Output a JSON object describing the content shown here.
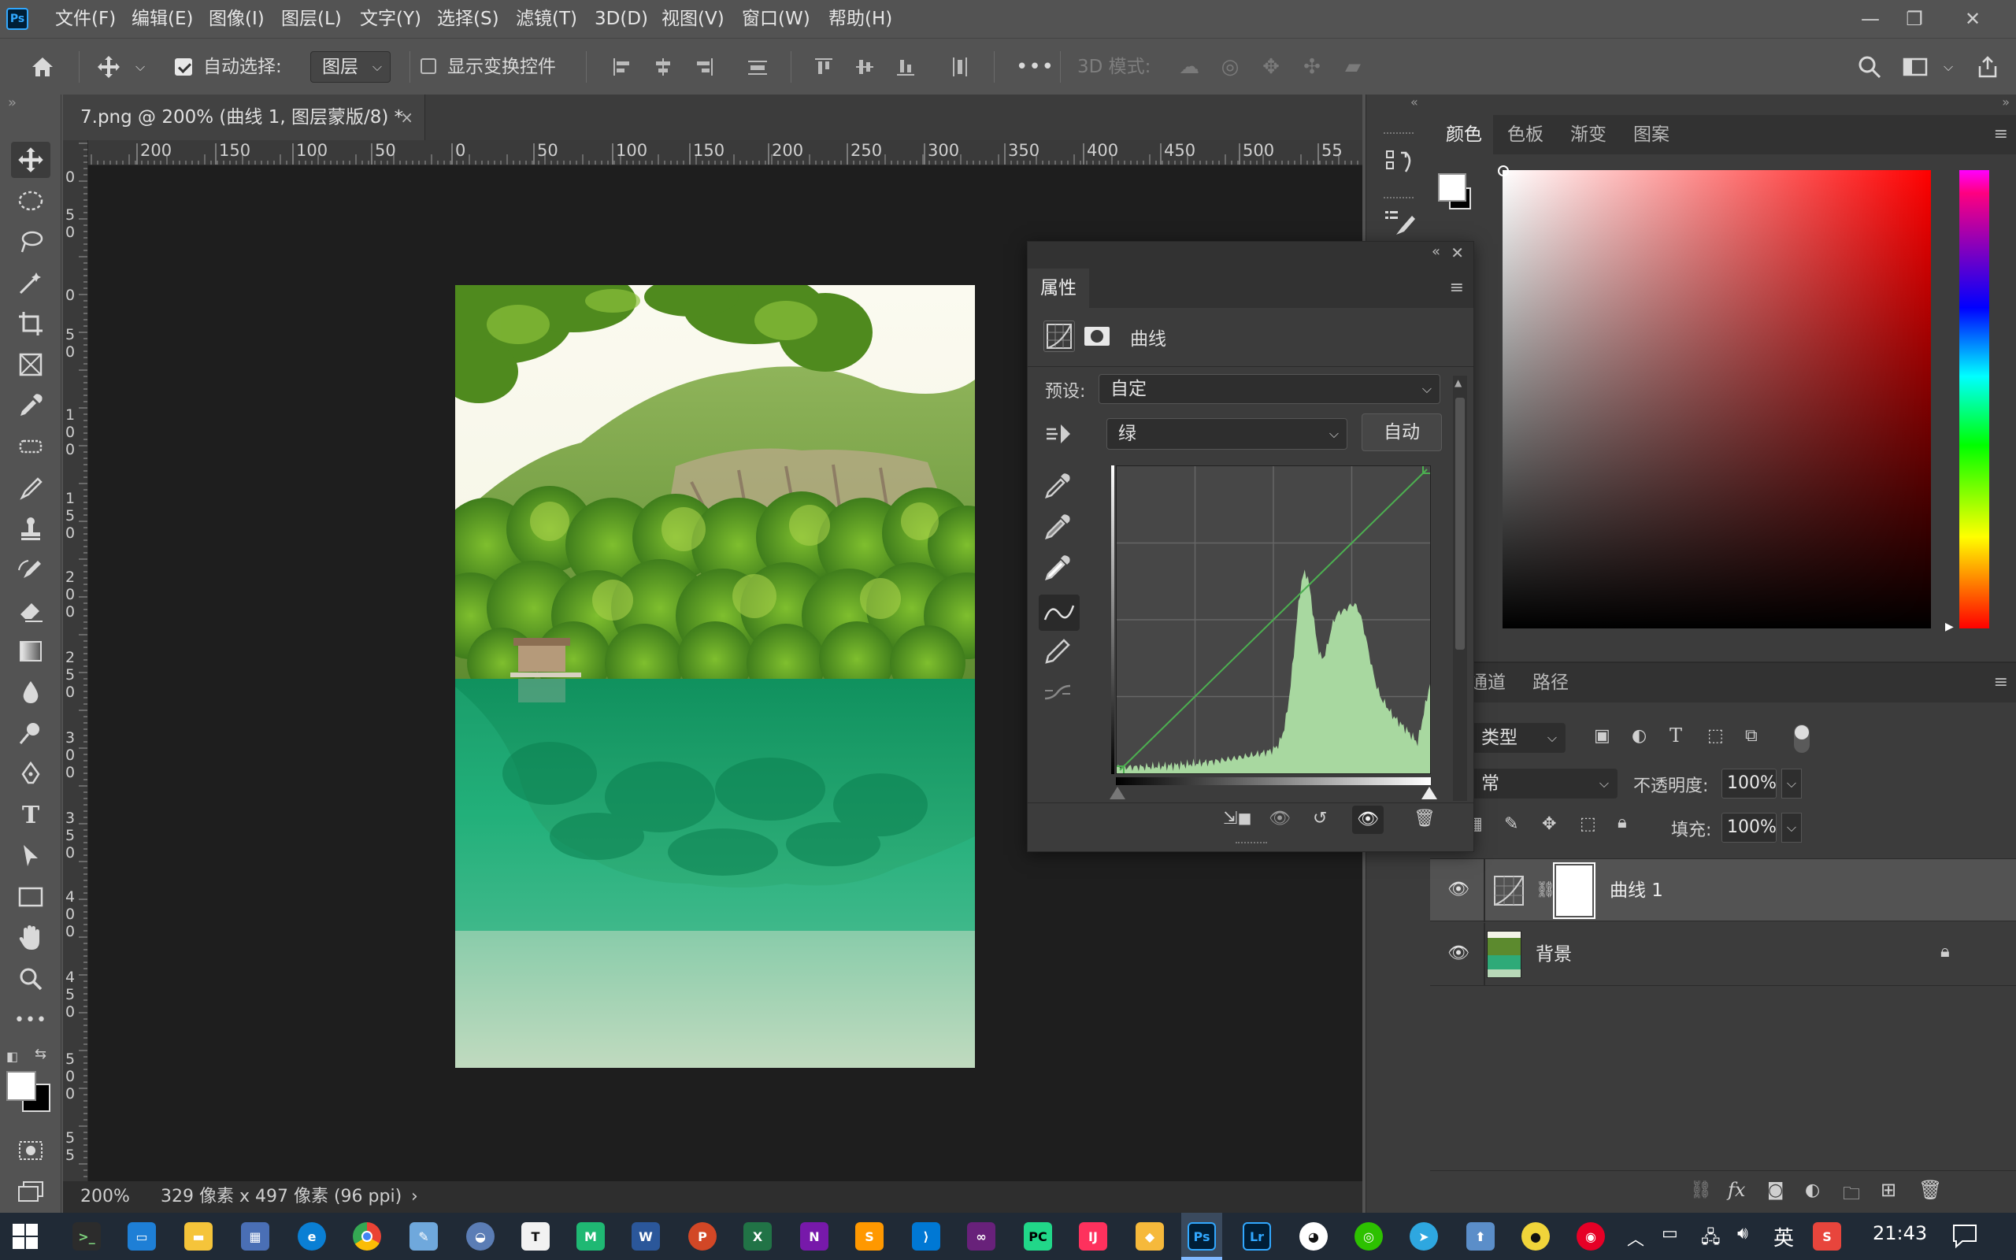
{
  "app": {
    "logo": "Ps"
  },
  "menu": [
    "文件(F)",
    "编辑(E)",
    "图像(I)",
    "图层(L)",
    "文字(Y)",
    "选择(S)",
    "滤镜(T)",
    "3D(D)",
    "视图(V)",
    "窗口(W)",
    "帮助(H)"
  ],
  "options": {
    "auto_select_label": "自动选择:",
    "auto_select_checked": true,
    "auto_select_value": "图层",
    "show_transform_label": "显示变换控件",
    "show_transform_checked": false,
    "mode_3d_label": "3D 模式:",
    "more": "•••"
  },
  "document": {
    "tab_title": "7.png @ 200% (曲线 1, 图层蒙版/8) *",
    "close": "×",
    "zoom": "200%",
    "info": "329 像素 x 497 像素 (96 ppi)",
    "info_arrow": "›"
  },
  "ruler": {
    "h": [
      "200",
      "150",
      "100",
      "50",
      "0",
      "50",
      "100",
      "150",
      "200",
      "250",
      "300",
      "350",
      "400",
      "450",
      "500",
      "55"
    ],
    "v": [
      "0",
      "5\n0",
      "0",
      "5\n0",
      "1\n0\n0",
      "1\n5\n0",
      "2\n0\n0",
      "2\n5\n0",
      "3\n0\n0",
      "3\n5\n0",
      "4\n0\n0",
      "4\n5\n0",
      "5\n0\n0",
      "5\n5"
    ]
  },
  "color_panel": {
    "tabs": [
      "颜色",
      "色板",
      "渐变",
      "图案"
    ],
    "active_tab": "颜色",
    "foreground": "#ffffff",
    "background": "#000000",
    "hue_color": "#ff0000"
  },
  "layers_panel": {
    "tabs": [
      "通道",
      "路径"
    ],
    "filter_label": "类型",
    "blend_mode": "常",
    "opacity_label": "不透明度:",
    "opacity": "100%",
    "lock_label": ":",
    "fill_label": "填充:",
    "fill": "100%",
    "layers": [
      {
        "name": "曲线 1",
        "visible": true,
        "selected": true,
        "type": "adjustment"
      },
      {
        "name": "背景",
        "visible": true,
        "selected": false,
        "locked": true,
        "type": "image"
      }
    ]
  },
  "properties": {
    "title": "属性",
    "subtitle": "曲线",
    "preset_label": "预设:",
    "preset_value": "自定",
    "channel_value": "绿",
    "auto_button": "自动",
    "curve_color": "#4caf50",
    "histogram_color": "#a8d8a0"
  },
  "taskbar": {
    "time": "21:43",
    "ime": "英"
  }
}
